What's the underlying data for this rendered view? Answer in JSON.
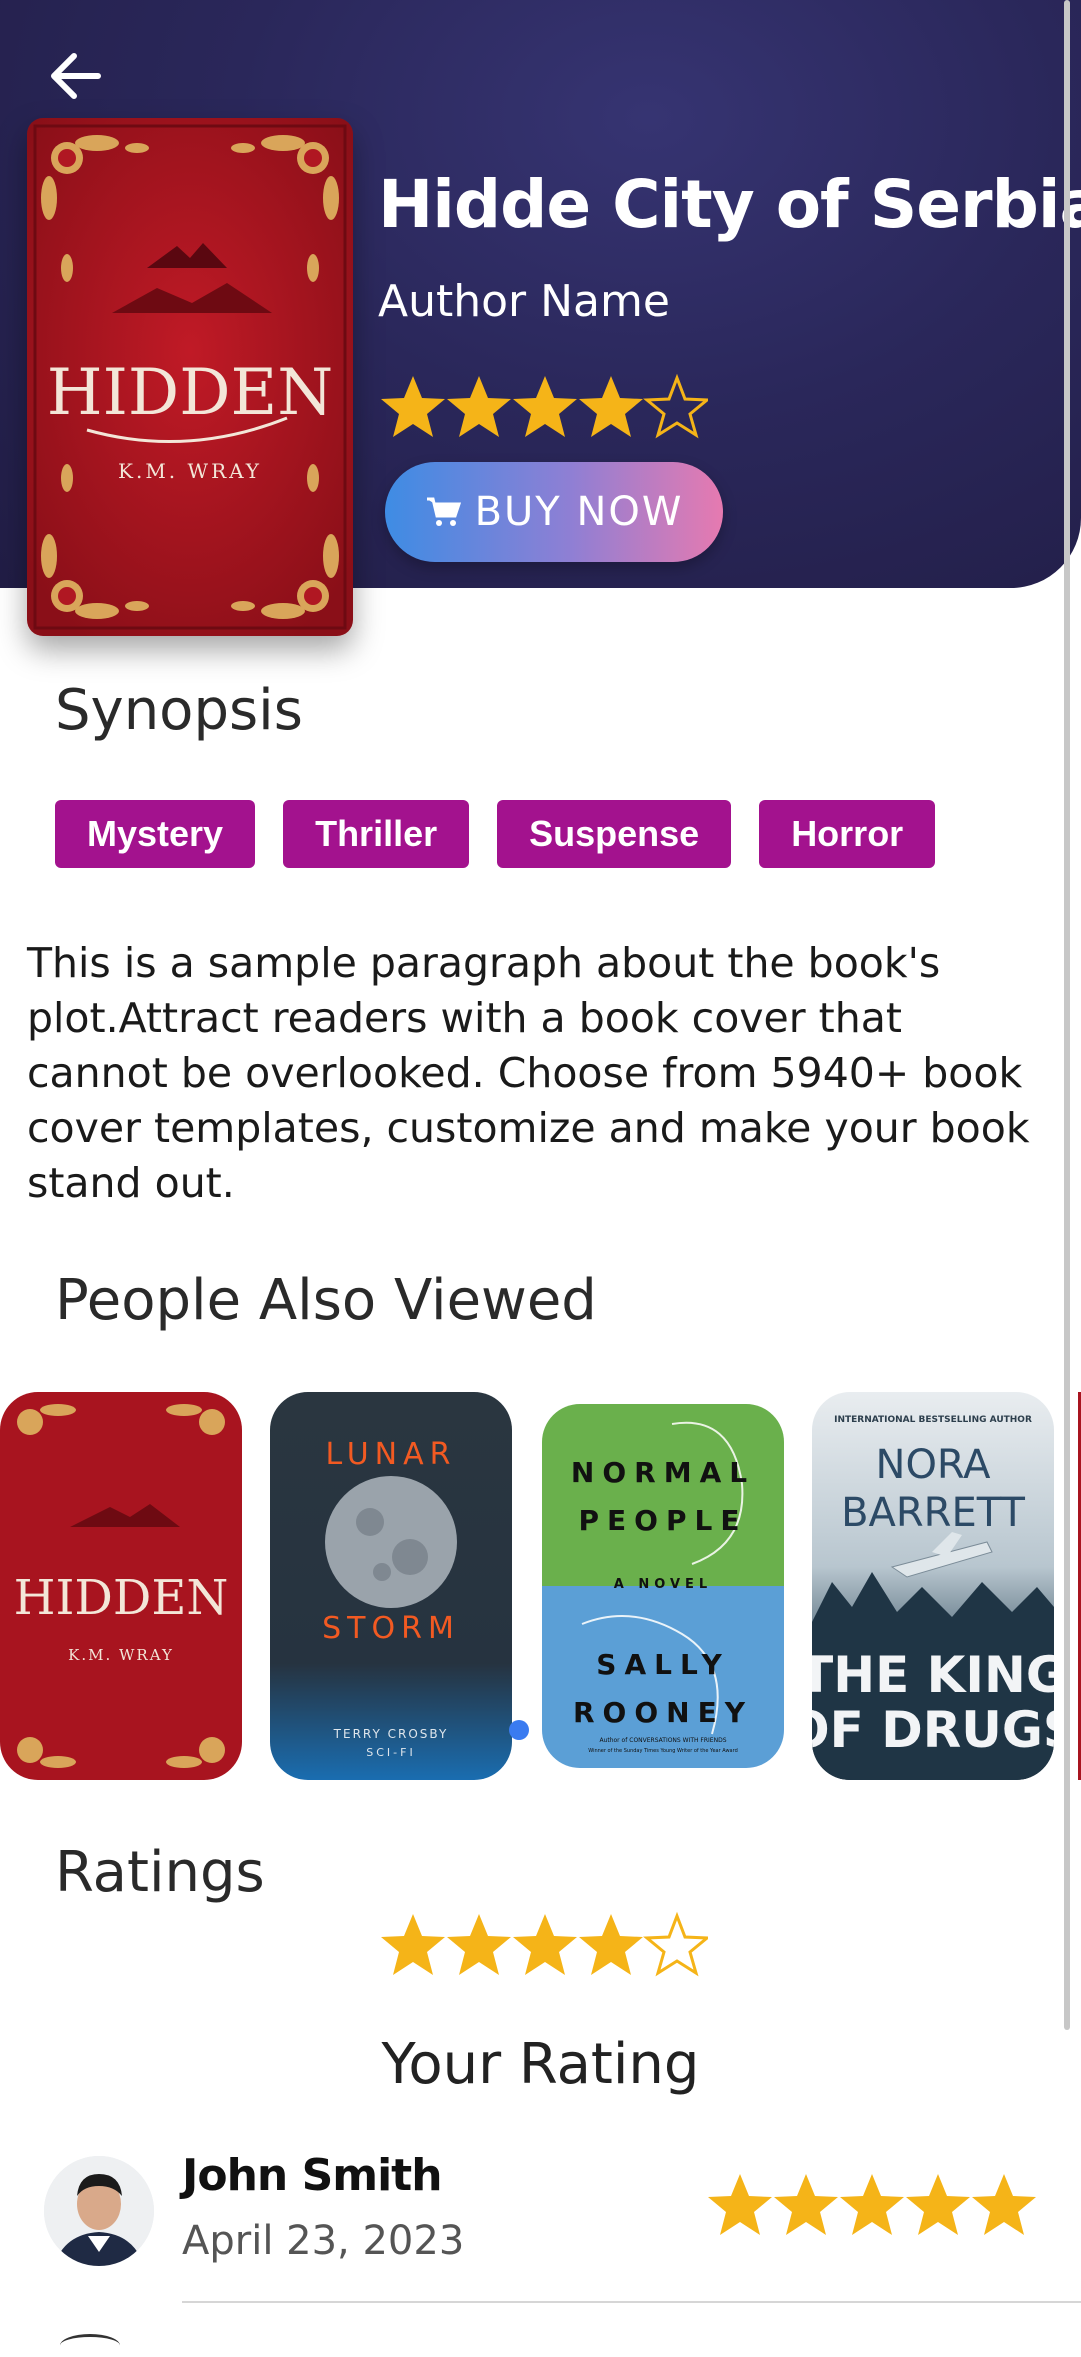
{
  "header": {
    "title": "Hidde City of Serbia",
    "author": "Author Name",
    "rating": 4,
    "rating_max": 5,
    "buy_label": "BUY NOW"
  },
  "main_cover": {
    "title": "HIDDEN",
    "author": "K.M. WRAY",
    "colors": {
      "bg": "#a8141f",
      "ornament": "#d9a55a"
    }
  },
  "synopsis": {
    "heading": "Synopsis",
    "tags": [
      "Mystery",
      "Thriller",
      "Suspense",
      "Horror"
    ],
    "text": "This is a sample paragraph about the book's plot.Attract readers with a book cover that cannot be overlooked. Choose from 5940+ book cover templates, customize and make your book stand out."
  },
  "also_viewed": {
    "heading": "People Also Viewed",
    "books": [
      {
        "title": "HIDDEN",
        "author": "K.M. WRAY"
      },
      {
        "title_top": "LUNAR",
        "title_bottom": "STORM",
        "author": "TERRY CROSBY",
        "genre": "SCI-FI"
      },
      {
        "title_line1": "NORMAL",
        "title_line2": "PEOPLE",
        "subtitle": "A NOVEL",
        "author_line1": "SALLY",
        "author_line2": "ROONEY",
        "blurb_1": "Author of CONVERSATIONS WITH FRIENDS",
        "blurb_2": "Winner of the Sunday Times Young Writer of the Year Award"
      },
      {
        "banner": "INTERNATIONAL BESTSELLING AUTHOR",
        "author_line1": "NORA",
        "author_line2": "BARRETT",
        "title_line1": "THE KING",
        "title_line2": "OF DRUGS"
      }
    ]
  },
  "ratings": {
    "heading": "Ratings",
    "value": 4,
    "max": 5,
    "your_rating_label": "Your Rating"
  },
  "reviews": [
    {
      "name": "John Smith",
      "date": "April 23, 2023",
      "stars": 5
    }
  ],
  "colors": {
    "header_bg": "#2a275a",
    "tag_bg": "#a3128e",
    "star": "#f5b418",
    "buy_gradient_start": "#3e8ce4",
    "buy_gradient_end": "#e67ab0"
  }
}
